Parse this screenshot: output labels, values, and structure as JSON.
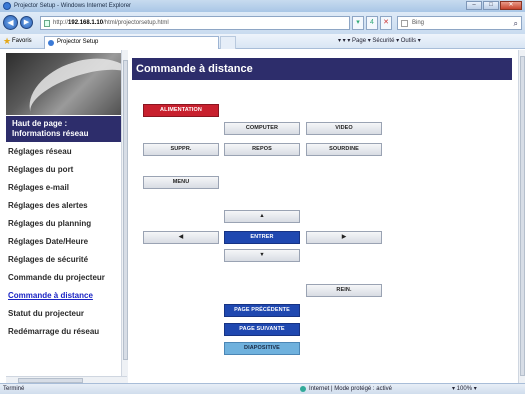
{
  "window": {
    "title": "Projector Setup - Windows Internet Explorer",
    "buttons": {
      "minimize": "–",
      "maximize": "□",
      "close": "✕"
    }
  },
  "address_bar": {
    "url_prefix": "http://",
    "url_host": "192.168.1.10",
    "url_path": "/html/projectorsetup.html",
    "refresh": "4",
    "stop": "✕",
    "search_placeholder": "Bing",
    "search_icon": "search-icon"
  },
  "favorites_bar": {
    "favorites_label": "Favoris",
    "tab_label": "Projector Setup",
    "commands": "▾  ▾  ▾  Page ▾  Sécurité ▾  Outils ▾"
  },
  "sidebar": {
    "items": [
      {
        "label": "Haut de page :",
        "label2": "Informations réseau"
      },
      {
        "label": "Réglages réseau"
      },
      {
        "label": "Réglages du port"
      },
      {
        "label": "Réglages e-mail"
      },
      {
        "label": "Réglages des alertes"
      },
      {
        "label": "Réglages du planning"
      },
      {
        "label": "Réglages Date/Heure"
      },
      {
        "label": "Réglages de sécurité"
      },
      {
        "label": "Commande du projecteur"
      },
      {
        "label": "Commande à distance"
      },
      {
        "label": "Statut du projecteur"
      },
      {
        "label": "Redémarrage du réseau"
      }
    ]
  },
  "main": {
    "title": "Commande à distance",
    "buttons": {
      "alimentation": "ALIMENTATION",
      "computer": "COMPUTER",
      "video": "VIDEO",
      "suppr": "SUPPR.",
      "repos": "REPOS",
      "sourdine": "SOURDINE",
      "menu": "MENU",
      "up": "▲",
      "left": "◀",
      "enter": "ENTRER",
      "right": "▶",
      "down": "▼",
      "rein": "REIN.",
      "page_prev": "PAGE PRÉCÉDENTE",
      "page_next": "PAGE SUIVANTE",
      "diaporama": "DIAPOSITIVE"
    }
  },
  "status_bar": {
    "left": "Terminé",
    "zone": "Internet | Mode protégé : activé",
    "zoom": "▾  100%  ▾"
  },
  "colors": {
    "header_bg": "#2d2d6b",
    "power_button": "#c8202e",
    "enter_button": "#1f48b0",
    "slide_button": "#6fb1dd",
    "active_link": "#1a24c4"
  }
}
